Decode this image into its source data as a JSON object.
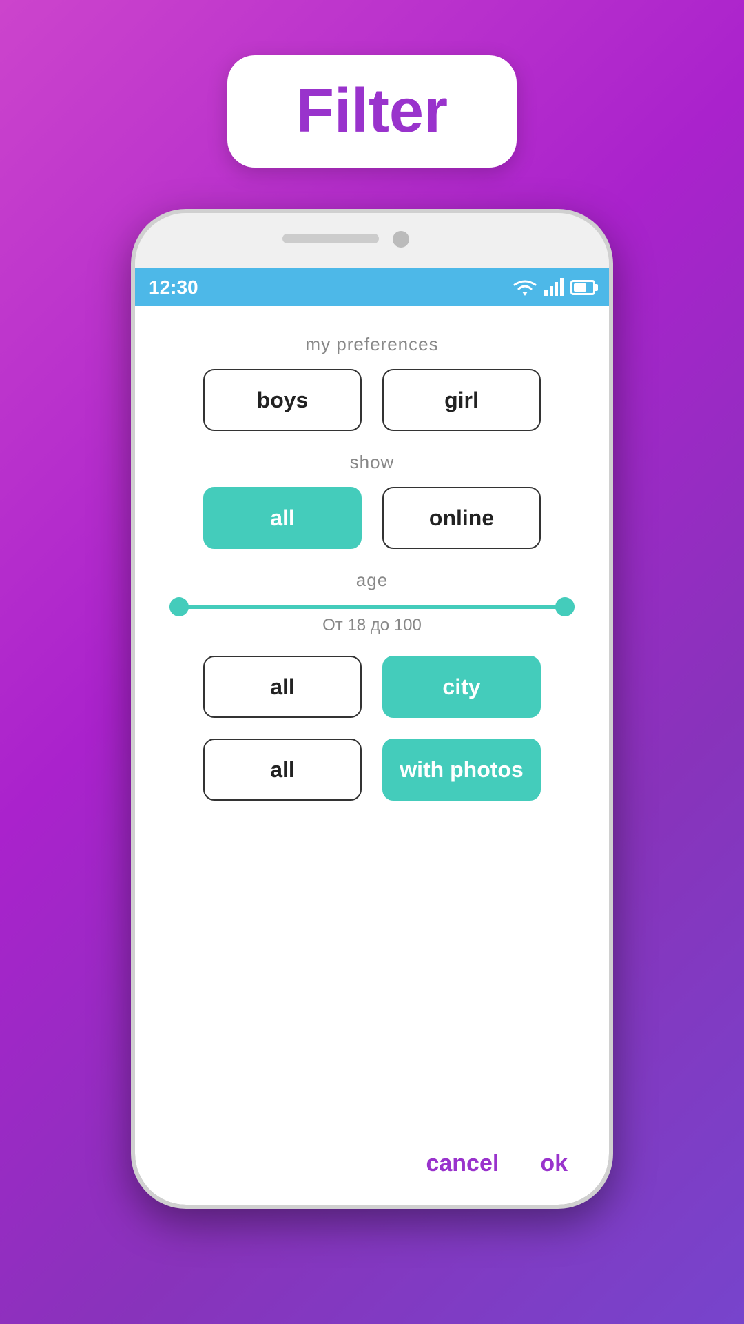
{
  "background": {
    "gradient_start": "#cc44cc",
    "gradient_end": "#7744cc"
  },
  "filter_card": {
    "title": "Filter",
    "border_radius": "40px"
  },
  "phone": {
    "status_bar": {
      "time": "12:30",
      "bg_color": "#4db8e8"
    }
  },
  "dialog": {
    "section_preferences": "my preferences",
    "preferences_buttons": [
      {
        "label": "boys",
        "active": false
      },
      {
        "label": "girl",
        "active": false
      }
    ],
    "section_show": "show",
    "show_buttons": [
      {
        "label": "all",
        "active": true
      },
      {
        "label": "online",
        "active": false
      }
    ],
    "section_age": "age",
    "age_range_text": "От 18 до 100",
    "age_min": 18,
    "age_max": 100,
    "location_buttons": [
      {
        "label": "all",
        "active": false
      },
      {
        "label": "city",
        "active": true
      }
    ],
    "photo_buttons": [
      {
        "label": "all",
        "active": false
      },
      {
        "label": "with photos",
        "active": true
      }
    ],
    "cancel_label": "cancel",
    "ok_label": "ok"
  }
}
